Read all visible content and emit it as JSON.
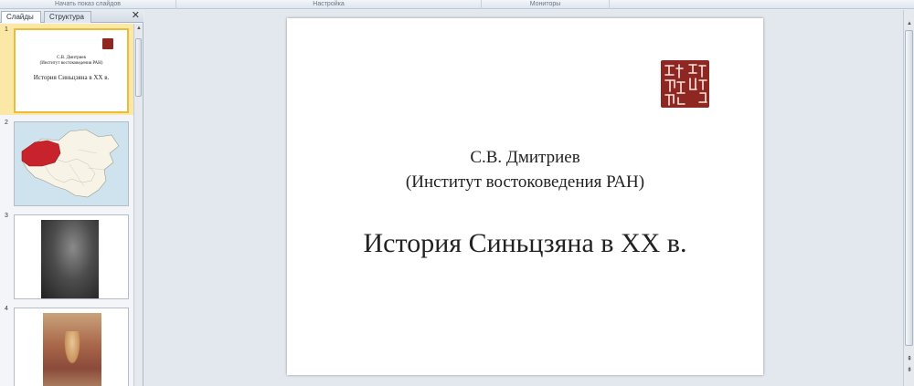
{
  "ribbon": {
    "groups": [
      "Начать показ слайдов",
      "Настройка",
      "Мониторы"
    ]
  },
  "left_pane": {
    "tabs": [
      "Слайды",
      "Структура"
    ],
    "close_glyph": "✕",
    "thumbnails": [
      {
        "number": "1",
        "author": "С.В. Дмитриев",
        "affiliation": "(Институт востоковедения РАН)",
        "title": "История Синьцзяна в XX в."
      },
      {
        "number": "2"
      },
      {
        "number": "3"
      },
      {
        "number": "4"
      }
    ]
  },
  "slide": {
    "author": "С.В. Дмитриев",
    "affiliation": "(Институт востоковедения РАН)",
    "title": "История Синьцзяна в XX в."
  },
  "colors": {
    "selected_thumb_bg": "#fbe8a6",
    "selected_thumb_border": "#e9bd3b",
    "seal_red": "#8e2622",
    "map_highlight": "#c8232c"
  },
  "icons": {
    "scroll_up": "▲",
    "prev_slide": "⇞",
    "next_slide": "⇟"
  }
}
